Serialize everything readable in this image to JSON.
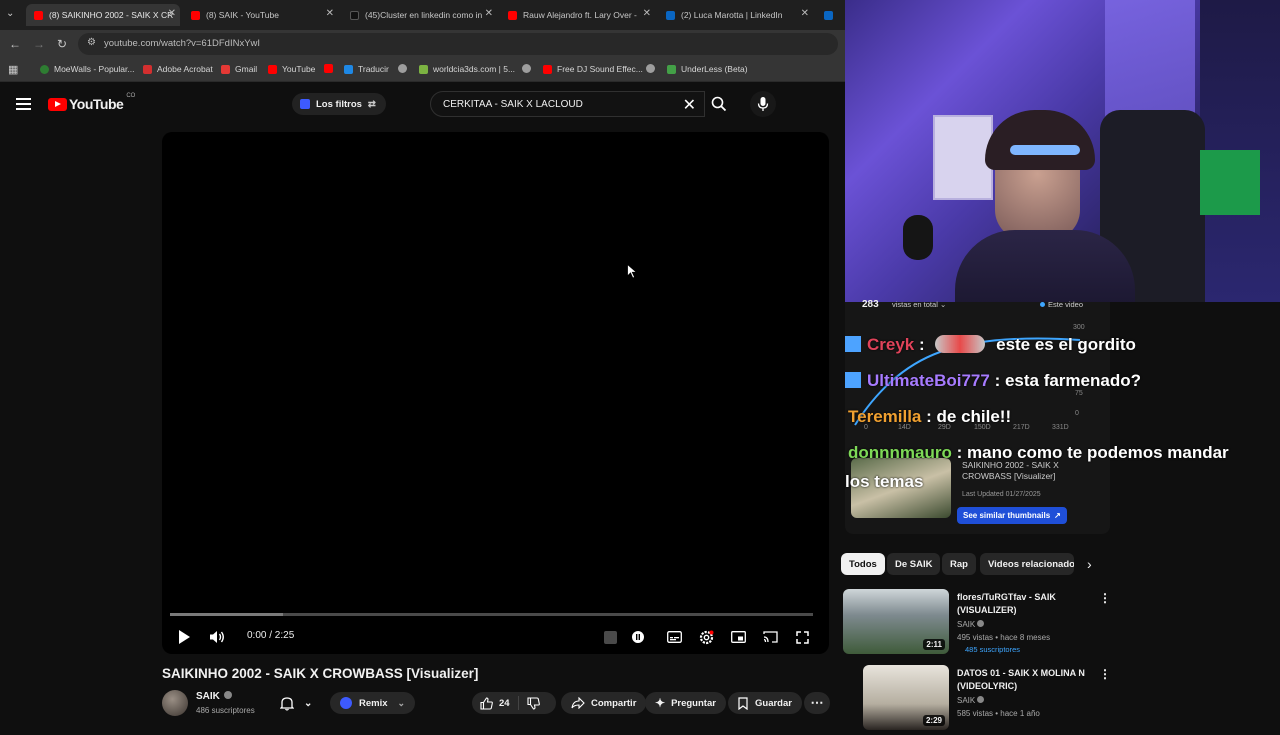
{
  "browser": {
    "tabs": [
      {
        "label": "(8) SAIKINHO 2002 - SAIK X CR",
        "fav": "yt",
        "active": true
      },
      {
        "label": "(8) SAIK - YouTube",
        "fav": "yt",
        "active": false
      },
      {
        "label": "(45)Cluster en linkedin como in",
        "fav": "tt",
        "active": false
      },
      {
        "label": "Rauw Alejandro ft. Lary Over -",
        "fav": "yt",
        "active": false
      },
      {
        "label": "(2) Luca Marotta | LinkedIn",
        "fav": "li",
        "active": false
      }
    ],
    "url": "youtube.com/watch?v=61DFdINxYwI",
    "bookmarks": [
      {
        "label": "MoeWalls - Popular...",
        "color": "#2e7d32"
      },
      {
        "label": "Adobe Acrobat",
        "color": "#d32f2f"
      },
      {
        "label": "Gmail",
        "color": "#e53935"
      },
      {
        "label": "YouTube",
        "color": "#ff0000"
      },
      {
        "label": "",
        "color": "#ff0000"
      },
      {
        "label": "Traducir",
        "color": "#1e88e5"
      },
      {
        "label": "",
        "color": "#9e9e9e"
      },
      {
        "label": "worldcia3ds.com | 5...",
        "color": "#7cb342"
      },
      {
        "label": "",
        "color": "#9e9e9e"
      },
      {
        "label": "Free DJ Sound Effec...",
        "color": "#ff0000"
      },
      {
        "label": "",
        "color": "#9e9e9e"
      },
      {
        "label": "UnderLess (Beta)",
        "color": "#43a047"
      }
    ]
  },
  "youtube": {
    "logo_text": "YouTube",
    "logo_country": "CO",
    "filters_label": "Los filtros",
    "search_value": "CERKITAA - SAIK X LACLOUD"
  },
  "player": {
    "time": "0:00 / 2:25",
    "buffered_fraction": 0.175
  },
  "video": {
    "title": "SAIKINHO 2002 - SAIK X CROWBASS [Visualizer]",
    "channel": "SAIK",
    "subscribers": "486 suscriptores",
    "remix_label": "Remix",
    "likes": "24",
    "share_label": "Compartir",
    "ask_label": "Preguntar",
    "save_label": "Guardar"
  },
  "stream_overlay": {
    "views_count": "283",
    "views_label": "vistas en total",
    "este_video": "Este video",
    "chart_y_ticks": [
      "300",
      "75",
      "0"
    ],
    "chart_x_ticks": [
      "0",
      "14D",
      "29D",
      "150D",
      "217D",
      "331D"
    ],
    "chat": [
      {
        "user": "Creyk",
        "user_color": "#e0435a",
        "message": "este es el gordito",
        "badge": true
      },
      {
        "user": "UltimateBoi777",
        "user_color": "#a77bff",
        "message": ": esta farmenado?",
        "badge": true
      },
      {
        "user": "Teremilla",
        "user_color": "#f0a030",
        "message": ": de chile!!",
        "badge": false
      },
      {
        "user": "donnnmauro",
        "user_color": "#7ed957",
        "message": ": mano como te podemos mandar",
        "message2": "los temas",
        "badge": false
      }
    ],
    "mini_title": "SAIKINHO 2002 - SAIK X CROWBASS [Visualizer]",
    "mini_updated": "Last Updated 01/27/2025",
    "similar_button": "See similar thumbnails"
  },
  "sidebar": {
    "chips": [
      {
        "label": "Todos",
        "selected": true
      },
      {
        "label": "De SAIK",
        "selected": false
      },
      {
        "label": "Rap",
        "selected": false
      },
      {
        "label": "Videos relacionado",
        "selected": false
      }
    ],
    "recommendations": [
      {
        "title": "flores/TuRGTfav - SAIK (VISUALIZER)",
        "channel": "SAIK",
        "meta": "495 vistas • hace 8 meses",
        "subs": "485 suscriptores",
        "duration": "2:11"
      },
      {
        "title": "DATOS 01 - SAIK X MOLINA N (VIDEOLYRIC)",
        "channel": "SAIK",
        "meta": "585 vistas • hace 1 año",
        "subs": "",
        "duration": "2:29"
      }
    ]
  }
}
